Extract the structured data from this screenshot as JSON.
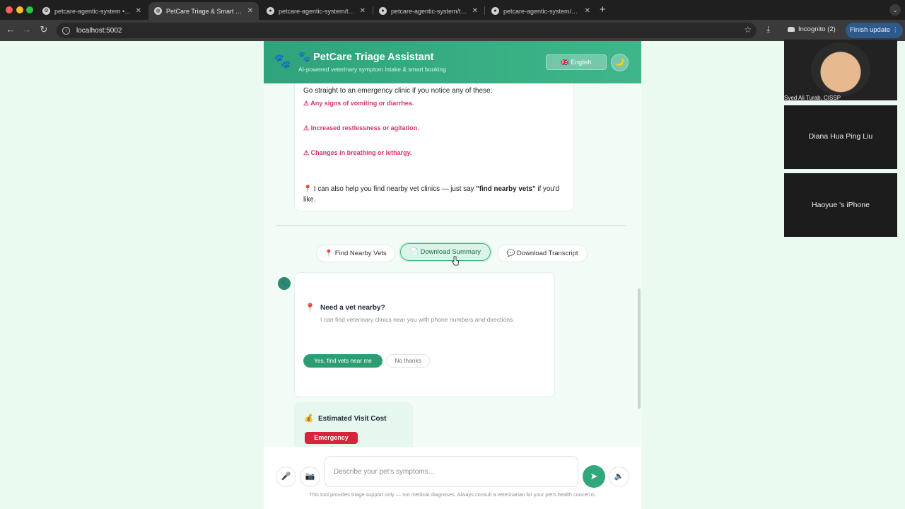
{
  "browser": {
    "tabs": [
      {
        "label": "petcare-agentic-system • W",
        "active": false
      },
      {
        "label": "PetCare Triage & Smart Booki",
        "active": true
      },
      {
        "label": "petcare-agentic-system/tech",
        "active": false
      },
      {
        "label": "petcare-agentic-system/test",
        "active": false
      },
      {
        "label": "petcare-agentic-system/docu",
        "active": false
      }
    ],
    "url": "localhost:5002",
    "incognito": "Incognito (2)",
    "finish_update": "Finish update"
  },
  "header": {
    "title": "🐾 PetCare Triage Assistant",
    "subtitle": "AI-powered veterinary symptom intake & smart booking",
    "language": "🇬🇧 English",
    "theme_icon": "🌙"
  },
  "message": {
    "intro": "Go straight to an emergency clinic if you notice any of these:",
    "warnings": [
      "⚠ Any signs of vomiting or diarrhea.",
      "⚠ Increased restlessness or agitation.",
      "⚠ Changes in breathing or lethargy."
    ],
    "vet_tip_prefix": "📍 I can also help you find nearby vet clinics — just say ",
    "vet_tip_bold": "\"find nearby vets\"",
    "vet_tip_suffix": " if you'd like."
  },
  "actions": {
    "find_vets": "📍 Find Nearby Vets",
    "download_summary": "📄 Download Summary",
    "download_transcript": "💬 Download Transcript"
  },
  "vet_card": {
    "title": "Need a vet nearby?",
    "description": "I can find veterinary clinics near you with phone numbers and directions.",
    "yes_label": "Yes, find vets near me",
    "no_label": "No thanks"
  },
  "cost_card": {
    "title": "Estimated Visit Cost",
    "badge": "Emergency"
  },
  "input": {
    "placeholder": "Describe your pet's symptoms...",
    "disclaimer": "This tool provides triage support only — not medical diagnoses. Always consult a veterinarian for your pet's health concerns."
  },
  "participants": [
    {
      "name": "Syed Ali Turab, CISSP"
    },
    {
      "name": "Diana Hua Ping Liu"
    },
    {
      "name": "Haoyue 's iPhone"
    }
  ],
  "colors": {
    "brand": "#3fb68a",
    "send": "#31a77c",
    "emergency": "#d6243a",
    "warning_text": "#d6336c"
  }
}
